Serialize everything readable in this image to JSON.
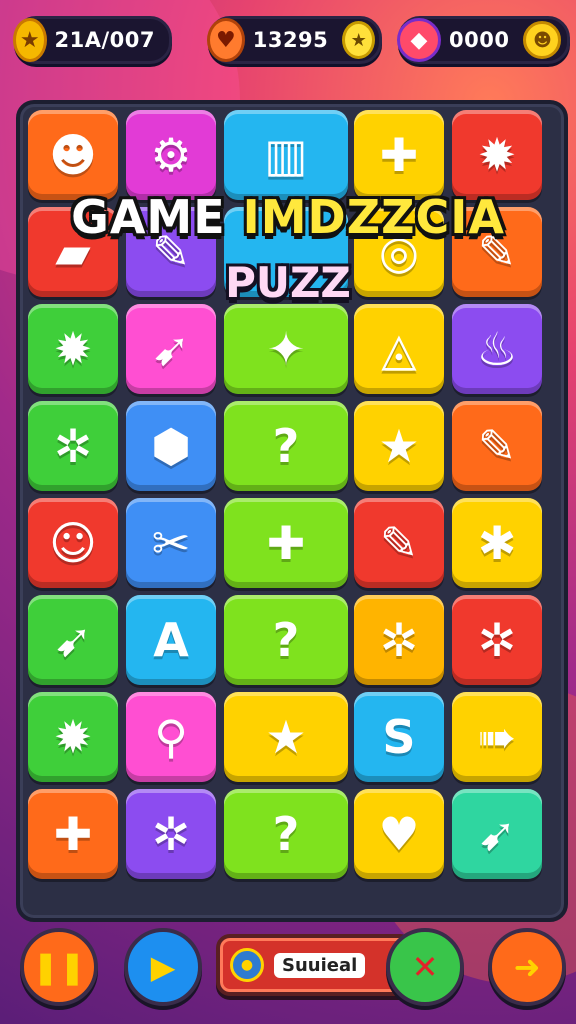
{
  "hud": {
    "score_a": "21A/007",
    "score_b": "13295",
    "score_c": "0000",
    "icons": {
      "a": "star-icon",
      "b_left": "heart-shield-icon",
      "b_right": "star-badge-icon",
      "c_left": "shield-icon",
      "c_right": "coin-icon"
    }
  },
  "title": {
    "line1_white": "GAME ",
    "line1_yellow": "IMDZZCIA",
    "line2": "PUZZ"
  },
  "board": {
    "rows": [
      [
        {
          "color": "orange",
          "icon": "smiley-chick-icon",
          "glyph": "☻"
        },
        {
          "color": "magenta",
          "icon": "gear-wrench-icon",
          "glyph": "⚙"
        },
        {
          "color": "cyan",
          "icon": "blocks-icon",
          "glyph": "▥"
        },
        {
          "color": "yellow",
          "icon": "puzzle-piece-icon",
          "glyph": "✚"
        },
        {
          "color": "red",
          "icon": "sun-smiley-icon",
          "glyph": "✹"
        }
      ],
      [
        {
          "color": "red",
          "icon": "book-icon",
          "glyph": "▰"
        },
        {
          "color": "purple",
          "icon": "crayon-icon",
          "glyph": "✎"
        },
        {
          "color": "cyan",
          "icon": "title-tile-icon",
          "glyph": ""
        },
        {
          "color": "yellow",
          "icon": "ring-icon",
          "glyph": "◎"
        },
        {
          "color": "orange",
          "icon": "pencil-icon",
          "glyph": "✎"
        }
      ],
      [
        {
          "color": "green",
          "icon": "sun-smiley-icon",
          "glyph": "✹"
        },
        {
          "color": "pink",
          "icon": "rocket-icon",
          "glyph": "➹"
        },
        {
          "color": "lime",
          "icon": "splat-star-icon",
          "glyph": "✦"
        },
        {
          "color": "yellow",
          "icon": "atom-icon",
          "glyph": "◬"
        },
        {
          "color": "purple",
          "icon": "balloon-icon",
          "glyph": "♨"
        }
      ],
      [
        {
          "color": "green",
          "icon": "gear-icon",
          "glyph": "✲"
        },
        {
          "color": "blue",
          "icon": "shield-icon",
          "glyph": "⬢"
        },
        {
          "color": "lime",
          "icon": "question-icon",
          "glyph": "?"
        },
        {
          "color": "yellow",
          "icon": "star-icon",
          "glyph": "★"
        },
        {
          "color": "orange",
          "icon": "pencil-icon",
          "glyph": "✎"
        }
      ],
      [
        {
          "color": "red",
          "icon": "cat-face-icon",
          "glyph": "☺"
        },
        {
          "color": "blue",
          "icon": "tools-icon",
          "glyph": "✂"
        },
        {
          "color": "lime",
          "icon": "cross-icon",
          "glyph": "✚"
        },
        {
          "color": "red",
          "icon": "pencil-icon",
          "glyph": "✎"
        },
        {
          "color": "yellow",
          "icon": "puzzle-star-icon",
          "glyph": "✱"
        }
      ],
      [
        {
          "color": "green",
          "icon": "crayon-icon",
          "glyph": "➹"
        },
        {
          "color": "cyan",
          "icon": "letter-a-icon",
          "glyph": "A"
        },
        {
          "color": "lime",
          "icon": "question-icon",
          "glyph": "?"
        },
        {
          "color": "gold",
          "icon": "gear-icon",
          "glyph": "✲"
        },
        {
          "color": "red",
          "icon": "gear-icon",
          "glyph": "✲"
        }
      ],
      [
        {
          "color": "green",
          "icon": "sun-smiley-icon",
          "glyph": "✹"
        },
        {
          "color": "pink",
          "icon": "key-icon",
          "glyph": "⚲"
        },
        {
          "color": "yellow",
          "icon": "star-icon",
          "glyph": "★"
        },
        {
          "color": "cyan",
          "icon": "letter-s-icon",
          "glyph": "S"
        },
        {
          "color": "yellow",
          "icon": "arrow-sign-icon",
          "glyph": "➠"
        }
      ],
      [
        {
          "color": "orange",
          "icon": "puzzle-piece-icon",
          "glyph": "✚"
        },
        {
          "color": "purple",
          "icon": "gear-icon",
          "glyph": "✲"
        },
        {
          "color": "lime",
          "icon": "question-icon",
          "glyph": "?"
        },
        {
          "color": "yellow",
          "icon": "heart-icon",
          "glyph": "♥"
        },
        {
          "color": "teal",
          "icon": "crayon-icon",
          "glyph": "➹"
        }
      ]
    ]
  },
  "footer": {
    "status_label": "Suuieal",
    "buttons": [
      "pause-button",
      "play-button",
      "close-button",
      "next-button"
    ]
  },
  "colors": {
    "orange": "#ff6a1a",
    "red": "#f0392d",
    "pink": "#ff4fd2",
    "magenta": "#e23bd6",
    "purple": "#8c4cf0",
    "blue": "#3f8ff5",
    "cyan": "#24b6f0",
    "green": "#3fcf3a",
    "lime": "#7fe21e",
    "yellow": "#ffd200",
    "teal": "#2fd6a0",
    "gold": "#ffb400"
  }
}
